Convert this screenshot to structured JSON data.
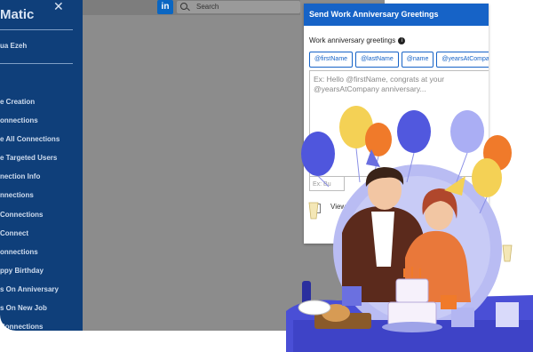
{
  "sidebar": {
    "brand": "Matic",
    "user_name": "ua Ezeh",
    "items": [
      {
        "label": "e Creation"
      },
      {
        "label": "onnections"
      },
      {
        "label": "e All Connections"
      },
      {
        "label": "e Targeted Users"
      },
      {
        "label": "nection Info"
      },
      {
        "label": "nnections"
      },
      {
        "label": "Connections"
      },
      {
        "label": "Connect"
      },
      {
        "label": "onnections"
      },
      {
        "label": "ppy Birthday"
      },
      {
        "label": "s On Anniversary"
      },
      {
        "label": "s On New Job"
      },
      {
        "label": "Connections"
      }
    ]
  },
  "topbar": {
    "logo": "in",
    "search_placeholder": "Search"
  },
  "modal": {
    "title": "Send Work Anniversary Greetings",
    "field_label": "Work anniversary greetings",
    "chips": [
      "@firstName",
      "@lastName",
      "@name",
      "@yearsAtCompany"
    ],
    "textarea_placeholder": "Ex: Hello @firstName, congrats at your @yearsAtCompany anniversary...",
    "ex_input_placeholder": "Ex: Bu",
    "checkbox_label": "View"
  },
  "colors": {
    "sidebar_bg": "#0f3f7a",
    "header_blue": "#1663c7",
    "illustration_purple": "#4950d8"
  }
}
